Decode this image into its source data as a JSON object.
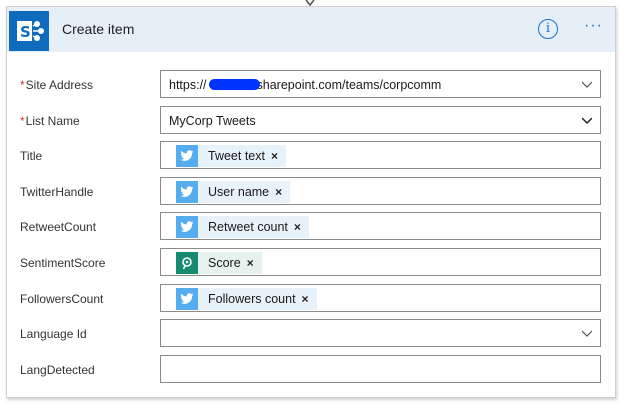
{
  "header": {
    "title": "Create item",
    "info_label": "i",
    "more_label": "···"
  },
  "fields": {
    "site_address": {
      "label": "Site Address",
      "required_mark": "*",
      "value": "https://"
    },
    "site_address_suffix": "sharepoint.com/teams/corpcomm",
    "list_name": {
      "label": "List Name",
      "required_mark": "*",
      "value": "MyCorp Tweets"
    },
    "title": {
      "label": "Title",
      "token": "Tweet text"
    },
    "twitter_handle": {
      "label": "TwitterHandle",
      "token": "User name"
    },
    "retweet_count": {
      "label": "RetweetCount",
      "token": "Retweet count"
    },
    "sentiment_score": {
      "label": "SentimentScore",
      "token": "Score"
    },
    "followers_count": {
      "label": "FollowersCount",
      "token": "Followers count"
    },
    "language_id": {
      "label": "Language Id",
      "value": ""
    },
    "lang_detected": {
      "label": "LangDetected",
      "value": ""
    }
  },
  "token_remove_glyph": "×",
  "colors": {
    "header_bg": "#e6eff8",
    "sharepoint_blue": "#0f6cbd",
    "twitter_blue": "#55acee",
    "sentiment_green": "#178b72",
    "required_red": "#d13438",
    "accent_blue": "#1672c9"
  },
  "icons": {
    "app": "sharepoint-icon",
    "twitter": "twitter-bird-icon",
    "sentiment": "text-analytics-icon",
    "info": "info-icon",
    "more": "ellipsis-icon",
    "dropdown": "chevron-down-icon"
  }
}
